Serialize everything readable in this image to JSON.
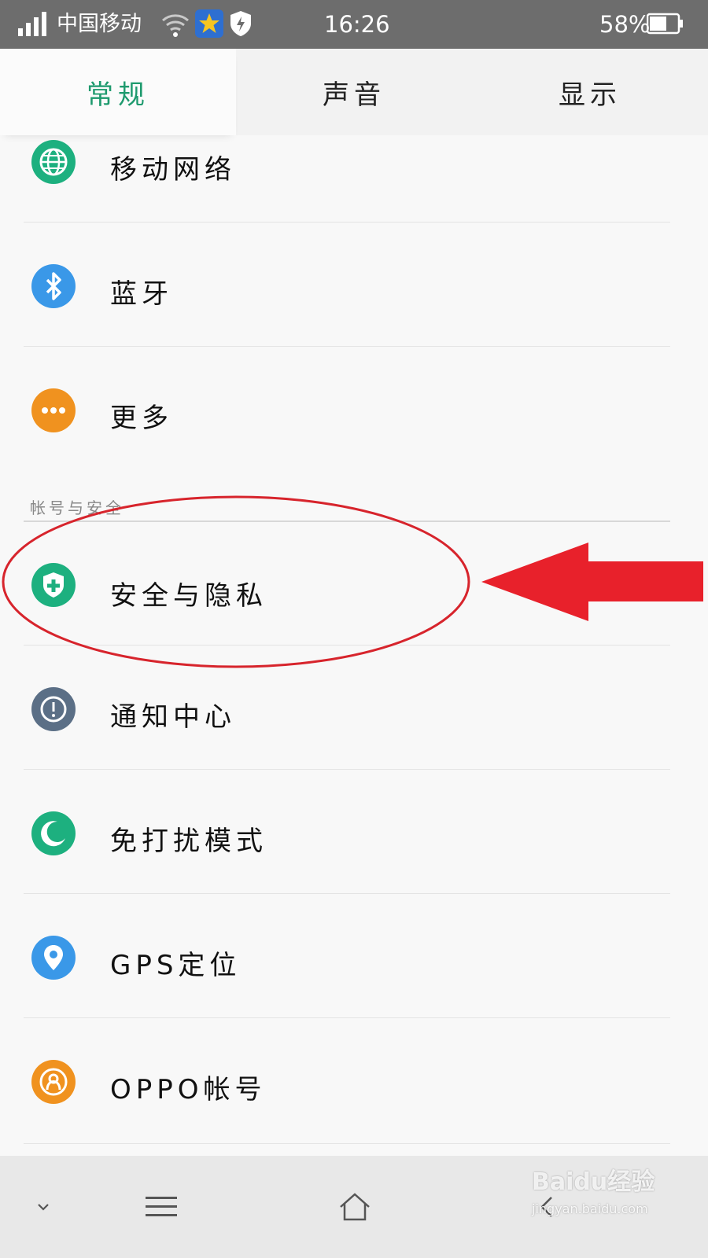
{
  "status_bar": {
    "carrier": "中国移动",
    "time": "16:26",
    "battery": "58%"
  },
  "tabs": [
    {
      "label": "常规",
      "active": true
    },
    {
      "label": "声音",
      "active": false
    },
    {
      "label": "显示",
      "active": false
    }
  ],
  "list": {
    "items_top": [
      {
        "label": "移动网络",
        "icon": "globe-icon",
        "color": "#1db07f"
      },
      {
        "label": "蓝牙",
        "icon": "bluetooth-icon",
        "color": "#3a98e8"
      },
      {
        "label": "更多",
        "icon": "more-dots-icon",
        "color": "#f0921f"
      }
    ],
    "section_header": "帐号与安全",
    "items_bottom": [
      {
        "label": "安全与隐私",
        "icon": "shield-plus-icon",
        "color": "#1db07f"
      },
      {
        "label": "通知中心",
        "icon": "exclamation-icon",
        "color": "#5b6f86"
      },
      {
        "label": "免打扰模式",
        "icon": "moon-icon",
        "color": "#1db07f"
      },
      {
        "label": "GPS定位",
        "icon": "location-pin-icon",
        "color": "#3a98e8"
      },
      {
        "label": "OPPO帐号",
        "icon": "user-icon",
        "color": "#f0921f"
      }
    ]
  },
  "annotation": {
    "highlight_color": "#d7242c",
    "arrow_color": "#e8212b"
  },
  "navbar": {
    "buttons": [
      "chevron-down-icon",
      "menu-icon",
      "home-icon",
      "back-icon"
    ]
  },
  "watermark": {
    "text": "Baidu经验",
    "url": "jingyan.baidu.com"
  }
}
